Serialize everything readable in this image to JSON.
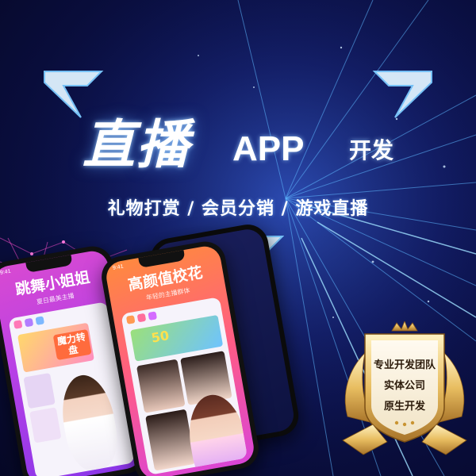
{
  "headline": {
    "main": "直播",
    "app": "APP",
    "dev": "开发"
  },
  "subtitle": "礼物打赏 / 会员分销 / 游戏直播",
  "phones": [
    {
      "title": "跳舞小姐姐",
      "subtitle": "夏日最美主播",
      "status_time": "9:41",
      "banner": "魔力转盘"
    },
    {
      "title": "高颜值校花",
      "subtitle": "年轻的主播群体",
      "status_time": "9:41",
      "banner": "50"
    }
  ],
  "badge": {
    "line1": "专业开发团队",
    "line2": "实体公司",
    "line3": "原生开发"
  },
  "colors": {
    "bg_dark": "#060826",
    "bg_blue": "#1b2f86",
    "neon": "#8fd0ff",
    "gold": "#d9a94a",
    "pink": "#d94ad1",
    "orange": "#ff8a3d"
  }
}
